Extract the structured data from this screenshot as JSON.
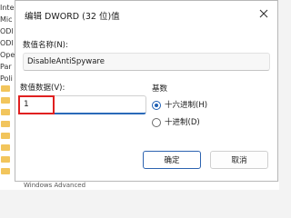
{
  "background": {
    "tree_items": [
      "Inte",
      "Mic",
      "ODI",
      "ODI",
      "Ope",
      "Par",
      "Poli"
    ],
    "status_text": "Windows Advanced"
  },
  "dialog": {
    "title": "编辑 DWORD (32 位)值",
    "close_icon": "close-icon",
    "value_name_label": "数值名称(N):",
    "value_name": "DisableAntiSpyware",
    "value_data_label": "数值数据(V):",
    "value_data": "1",
    "radix": {
      "label": "基数",
      "options": [
        {
          "label": "十六进制(H)",
          "checked": true
        },
        {
          "label": "十进制(D)",
          "checked": false
        }
      ]
    },
    "ok_label": "确定",
    "cancel_label": "取消"
  },
  "colors": {
    "accent": "#1f5fb4",
    "highlight": "#e02020"
  }
}
